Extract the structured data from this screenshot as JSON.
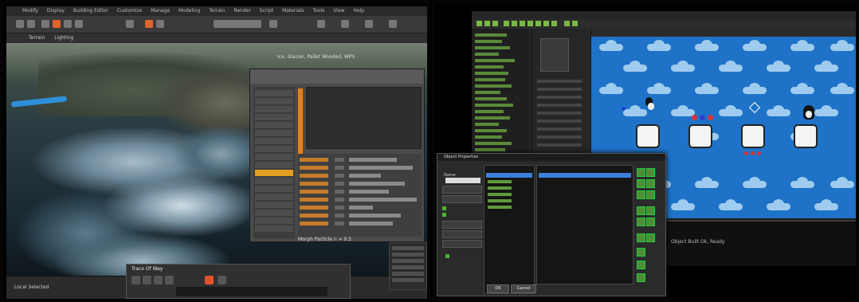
{
  "left_photo": {
    "menu": [
      "Modify",
      "Display",
      "Building Editor",
      "Customize",
      "Manage",
      "Modeling",
      "Terrain",
      "Render",
      "Script",
      "Materials",
      "Tools",
      "View",
      "Help"
    ],
    "tabs": [
      "Terrain",
      "Lighting"
    ],
    "scene_title": "Ice, Glacier, Pallet Wooded, WPS",
    "props_footer": "Morph Particle n = 0.5",
    "timeline_title": "Trace Of Way",
    "status_text": "Local Selected"
  },
  "right_photo": {
    "dialog_title": "Object Properties",
    "dialog_name_label": "Name",
    "dialog_ok": "OK",
    "dialog_cancel": "Cancel",
    "output_text": "Object Built Ok, Ready"
  }
}
